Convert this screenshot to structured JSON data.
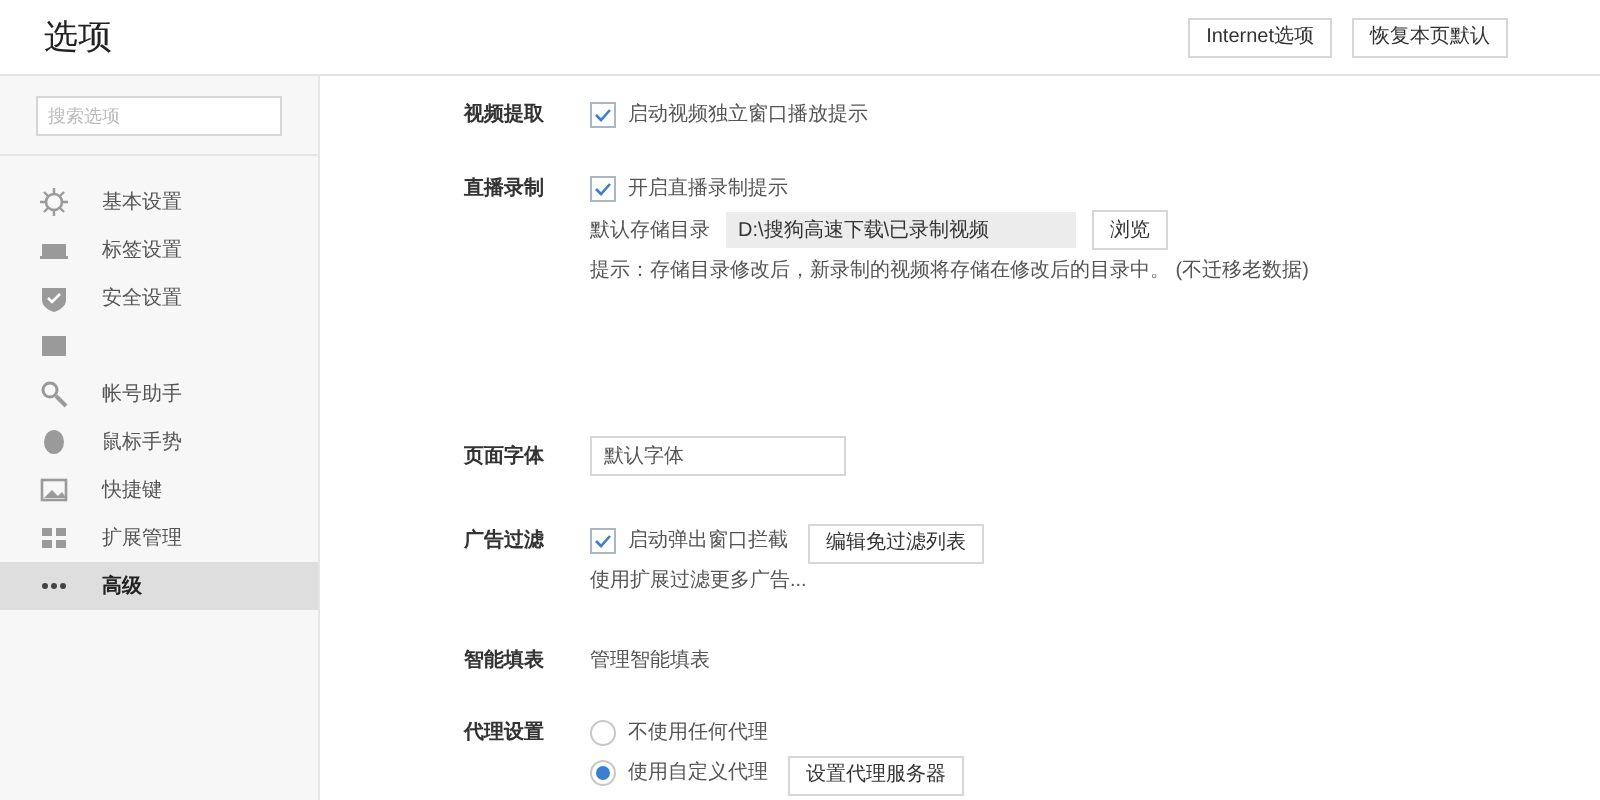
{
  "window": {
    "title": "选项"
  },
  "header_buttons": [
    "Internet选项",
    "恢复本页默认"
  ],
  "sidebar": {
    "search": {
      "placeholder": "搜索选项"
    },
    "items": [
      {
        "kind": "gear",
        "label": "基本设置",
        "selected": false
      },
      {
        "kind": "tab",
        "label": "标签设置",
        "selected": false
      },
      {
        "kind": "shield",
        "label": "安全设置",
        "selected": false
      },
      {
        "kind": "box",
        "selected": false
      },
      {
        "kind": "search",
        "label": "帐号助手",
        "selected": false
      },
      {
        "kind": "mouse",
        "label": "鼠标手势",
        "selected": false
      },
      {
        "kind": "key",
        "label": "快捷键",
        "selected": false
      },
      {
        "kind": "grid",
        "label": "扩展管理",
        "selected": false
      },
      {
        "kind": "dots",
        "label": "高级",
        "selected": true
      }
    ]
  },
  "sections": [
    {
      "title": "视频提取",
      "rows": [
        {
          "kind": "checkbox",
          "label": "启动视频独立窗口播放提示",
          "checked": true
        }
      ]
    },
    {
      "title": "直播录制",
      "rows": [
        {
          "kind": "checkbox",
          "label": "开启直播录制提示",
          "checked": true
        },
        {
          "kind": "path",
          "label": "默认存储目录",
          "value": "D:\\搜狗高速下载\\已录制视频",
          "button": "浏览"
        },
        {
          "kind": "text",
          "text": "提示：存储目录修改后，新录制的视频将存储在修改后的目录中。 (不迁移老数据)"
        }
      ]
    },
    {
      "title": "页面字体",
      "rows": [
        {
          "kind": "select",
          "value": "默认字体"
        }
      ]
    },
    {
      "title": "广告过滤",
      "rows": [
        {
          "kind": "checkbox",
          "label": "启动弹出窗口拦截",
          "checked": true,
          "button": "编辑免过滤列表"
        },
        {
          "kind": "link",
          "text": "使用扩展过滤更多广告..."
        }
      ]
    },
    {
      "title": "智能填表",
      "rows": [
        {
          "kind": "link",
          "text": "管理智能填表"
        }
      ]
    },
    {
      "title": "代理设置",
      "rows": [
        {
          "kind": "radio",
          "label": "不使用任何代理",
          "selected": false
        },
        {
          "kind": "radio",
          "label": "使用自定义代理",
          "selected": true,
          "button": "设置代理服务器"
        }
      ]
    }
  ]
}
